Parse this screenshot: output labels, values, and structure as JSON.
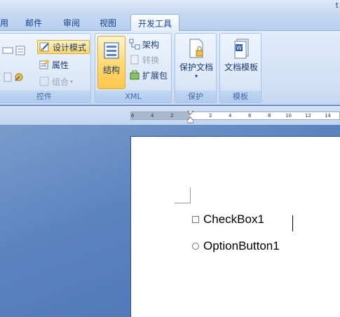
{
  "window": {
    "title_fragment": "t"
  },
  "tabs": {
    "t1": "用",
    "t2": "邮件",
    "t3": "审阅",
    "t4": "视图",
    "t5": "开发工具"
  },
  "ribbon": {
    "controls": {
      "design_mode": "设计模式",
      "properties": "属性",
      "group": "组合",
      "label": "控件"
    },
    "xml": {
      "structure": "结构",
      "schema": "架构",
      "transform": "转换",
      "expansion": "扩展包",
      "label": "XML"
    },
    "protect": {
      "protect_doc": "保护文档",
      "label": "保护"
    },
    "templates": {
      "doc_template": "文档模板",
      "label": "模板"
    }
  },
  "ruler": {
    "ticks": [
      "6",
      "4",
      "2",
      "2",
      "4",
      "6",
      "8",
      "10",
      "12",
      "14"
    ]
  },
  "document": {
    "checkbox_label": "CheckBox1",
    "option_label": "OptionButton1"
  },
  "colors": {
    "accent": "#ffd86a",
    "ribbon_text": "#15428b",
    "workspace": "#4a76b6"
  }
}
